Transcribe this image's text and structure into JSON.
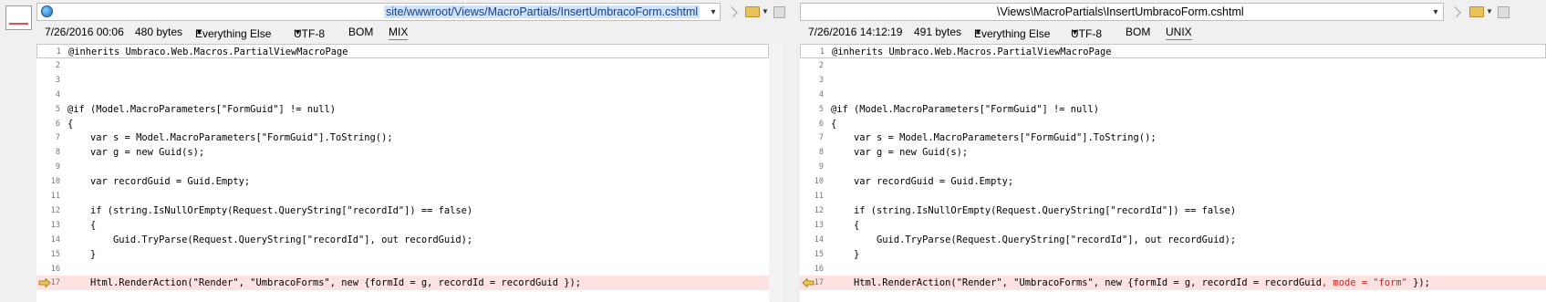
{
  "left": {
    "path": "site/wwwroot/Views/MacroPartials/InsertUmbracoForm.cshtml",
    "date": "7/26/2016 00:06",
    "size": "480 bytes",
    "filter": "Everything Else",
    "encoding": "UTF-8",
    "bom": "BOM",
    "line_ending": "MIX",
    "lines": [
      {
        "n": "1",
        "text": "@inherits Umbraco.Web.Macros.PartialViewMacroPage"
      },
      {
        "n": "2",
        "text": ""
      },
      {
        "n": "3",
        "text": ""
      },
      {
        "n": "4",
        "text": ""
      },
      {
        "n": "5",
        "text": "@if (Model.MacroParameters[\"FormGuid\"] != null)"
      },
      {
        "n": "6",
        "text": "{"
      },
      {
        "n": "7",
        "text": "    var s = Model.MacroParameters[\"FormGuid\"].ToString();"
      },
      {
        "n": "8",
        "text": "    var g = new Guid(s);"
      },
      {
        "n": "9",
        "text": ""
      },
      {
        "n": "10",
        "text": "    var recordGuid = Guid.Empty;"
      },
      {
        "n": "11",
        "text": ""
      },
      {
        "n": "12",
        "text": "    if (string.IsNullOrEmpty(Request.QueryString[\"recordId\"]) == false)"
      },
      {
        "n": "13",
        "text": "    {"
      },
      {
        "n": "14",
        "text": "        Guid.TryParse(Request.QueryString[\"recordId\"], out recordGuid);"
      },
      {
        "n": "15",
        "text": "    }"
      },
      {
        "n": "16",
        "text": ""
      },
      {
        "n": "17",
        "text": "    Html.RenderAction(\"Render\", \"UmbracoForms\", new {formId = g, recordId = recordGuid });"
      }
    ]
  },
  "right": {
    "path": "\\Views\\MacroPartials\\InsertUmbracoForm.cshtml",
    "date": "7/26/2016 14:12:19",
    "size": "491 bytes",
    "filter": "Everything Else",
    "encoding": "UTF-8",
    "bom": "BOM",
    "line_ending": "UNIX",
    "lines": [
      {
        "n": "1",
        "text": "@inherits Umbraco.Web.Macros.PartialViewMacroPage"
      },
      {
        "n": "2",
        "text": ""
      },
      {
        "n": "3",
        "text": ""
      },
      {
        "n": "4",
        "text": ""
      },
      {
        "n": "5",
        "text": "@if (Model.MacroParameters[\"FormGuid\"] != null)"
      },
      {
        "n": "6",
        "text": "{"
      },
      {
        "n": "7",
        "text": "    var s = Model.MacroParameters[\"FormGuid\"].ToString();"
      },
      {
        "n": "8",
        "text": "    var g = new Guid(s);"
      },
      {
        "n": "9",
        "text": ""
      },
      {
        "n": "10",
        "text": "    var recordGuid = Guid.Empty;"
      },
      {
        "n": "11",
        "text": ""
      },
      {
        "n": "12",
        "text": "    if (string.IsNullOrEmpty(Request.QueryString[\"recordId\"]) == false)"
      },
      {
        "n": "13",
        "text": "    {"
      },
      {
        "n": "14",
        "text": "        Guid.TryParse(Request.QueryString[\"recordId\"], out recordGuid);"
      },
      {
        "n": "15",
        "text": "    }"
      },
      {
        "n": "16",
        "text": ""
      },
      {
        "n": "17",
        "text": "    Html.RenderAction(\"Render\", \"UmbracoForms\", new {formId = g, recordId = recordGuid"
      }
    ],
    "line17_added": ", mode = \"form\"",
    "line17_tail": " });"
  },
  "colors": {
    "diff_line_bg": "#fde2e2",
    "diff_text": "#d02020",
    "marker_fill": "#f2c94c"
  }
}
